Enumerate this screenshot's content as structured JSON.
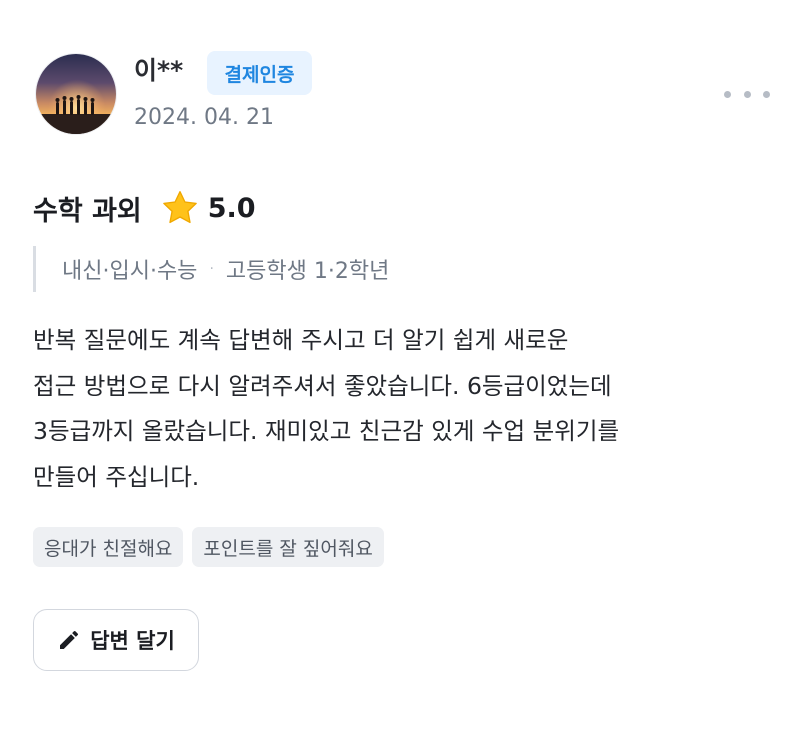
{
  "review": {
    "author": "이**",
    "badge": "결제인증",
    "date": "2024. 04. 21",
    "more_icon": "more-horizontal-icon",
    "subject": "수학 과외",
    "rating": "5.0",
    "rating_icon": "star-icon",
    "meta": {
      "course": "내신·입시·수능",
      "separator": "·",
      "grade": "고등학생 1·2학년"
    },
    "body_lines": [
      "반복 질문에도 계속 답변해 주시고 더 알기 쉽게 새로운",
      "접근 방법으로 다시 알려주셔서 좋았습니다. 6등급이었는데",
      "3등급까지 올랐습니다. 재미있고 친근감 있게 수업 분위기를",
      "만들어 주십니다."
    ],
    "tags": [
      "응대가 친절해요",
      "포인트를 잘 짚어줘요"
    ]
  },
  "actions": {
    "reply_label": "답변 달기",
    "reply_icon": "pencil-icon"
  },
  "colors": {
    "badge_bg": "#e8f3ff",
    "badge_text": "#1f86e0",
    "star": "#ffc21a",
    "muted_text": "#6f7885",
    "tag_bg": "#eef0f3"
  }
}
